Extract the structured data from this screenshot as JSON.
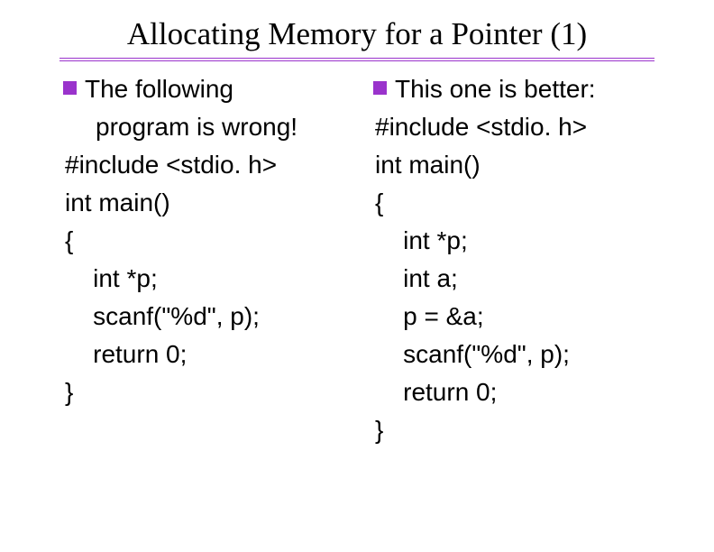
{
  "title": "Allocating Memory for a Pointer (1)",
  "left": {
    "bullet_intro_1": "The following",
    "bullet_intro_2": "program is wrong!",
    "code": [
      "#include <stdio. h>",
      "int main()",
      "{",
      "    int *p;",
      "    scanf(\"%d\", p);",
      "    return 0;",
      "}"
    ]
  },
  "right": {
    "bullet_intro_1": "This one is better:",
    "code": [
      "#include <stdio. h>",
      "int main()",
      "{",
      "    int *p;",
      "    int a;",
      "    p = &a;",
      "    scanf(\"%d\", p);",
      "    return 0;",
      "}"
    ]
  }
}
